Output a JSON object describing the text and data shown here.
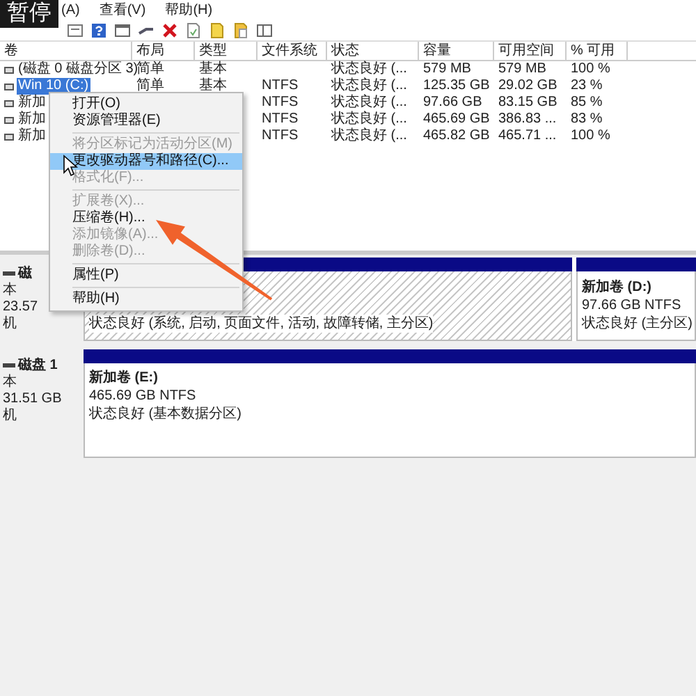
{
  "pause_label": "暂停",
  "menu_bar": [
    {
      "label": "(A)"
    },
    {
      "label": "查看(V)"
    },
    {
      "label": "帮助(H)"
    }
  ],
  "table": {
    "columns": [
      "卷",
      "布局",
      "类型",
      "文件系统",
      "状态",
      "容量",
      "可用空间",
      "% 可用"
    ],
    "rows": [
      {
        "selected": false,
        "cells": [
          "(磁盘 0 磁盘分区 3)",
          "简单",
          "基本",
          null,
          "状态良好 (...",
          "579 MB",
          "579 MB",
          "100 %"
        ]
      },
      {
        "selected": true,
        "cells": [
          "Win 10 (C:)",
          "简单",
          "基本",
          "NTFS",
          "状态良好 (...",
          "125.35 GB",
          "29.02 GB",
          "23 %"
        ]
      },
      {
        "selected": false,
        "cells": [
          "新加",
          null,
          null,
          "NTFS",
          "状态良好 (...",
          "97.66 GB",
          "83.15 GB",
          "85 %"
        ]
      },
      {
        "selected": false,
        "cells": [
          "新加",
          null,
          null,
          "NTFS",
          "状态良好 (...",
          "465.69 GB",
          "386.83 ...",
          "83 %"
        ]
      },
      {
        "selected": false,
        "cells": [
          "新加",
          null,
          null,
          "NTFS",
          "状态良好 (...",
          "465.82 GB",
          "465.71 ...",
          "100 %"
        ]
      }
    ]
  },
  "context_menu": {
    "items": [
      {
        "kind": "item",
        "label": "打开(O)",
        "disabled": false,
        "selected": false
      },
      {
        "kind": "item",
        "label": "资源管理器(E)",
        "disabled": false,
        "selected": false
      },
      {
        "kind": "separator"
      },
      {
        "kind": "item",
        "label": "将分区标记为活动分区(M)",
        "disabled": true,
        "selected": false
      },
      {
        "kind": "item",
        "label": "更改驱动器号和路径(C)...",
        "disabled": false,
        "selected": true
      },
      {
        "kind": "item",
        "label": "格式化(F)...",
        "disabled": true,
        "selected": false
      },
      {
        "kind": "separator"
      },
      {
        "kind": "item",
        "label": "扩展卷(X)...",
        "disabled": true,
        "selected": false
      },
      {
        "kind": "item",
        "label": "压缩卷(H)...",
        "disabled": false,
        "selected": false
      },
      {
        "kind": "item",
        "label": "添加镜像(A)...",
        "disabled": true,
        "selected": false
      },
      {
        "kind": "item",
        "label": "删除卷(D)...",
        "disabled": true,
        "selected": false
      },
      {
        "kind": "separator"
      },
      {
        "kind": "item",
        "label": "属性(P)",
        "disabled": false,
        "selected": false
      },
      {
        "kind": "separator"
      },
      {
        "kind": "item",
        "label": "帮助(H)",
        "disabled": false,
        "selected": false
      }
    ]
  },
  "disks": [
    {
      "name": "磁",
      "lines": [
        "本",
        "23.57",
        "机"
      ],
      "partitions": [
        {
          "selected": true,
          "lines": [
            "状态良好 (系统, 启动, 页面文件, 活动, 故障转储, 主分区)"
          ]
        },
        {
          "selected": false,
          "title": "新加卷 (D:)",
          "lines": [
            "97.66 GB NTFS",
            "状态良好 (主分区)"
          ]
        }
      ]
    },
    {
      "name": "磁盘 1",
      "lines": [
        "本",
        "31.51 GB",
        "机"
      ],
      "partitions": [
        {
          "selected": false,
          "title": "新加卷 (E:)",
          "lines": [
            "465.69 GB NTFS",
            "状态良好 (基本数据分区)"
          ]
        }
      ]
    }
  ]
}
